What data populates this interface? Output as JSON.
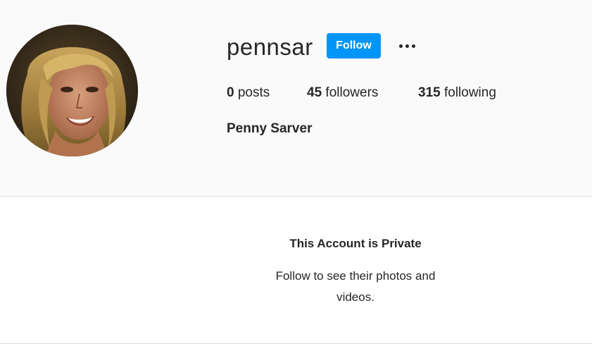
{
  "profile": {
    "username": "pennsar",
    "follow_label": "Follow",
    "full_name": "Penny Sarver",
    "stats": {
      "posts_count": "0",
      "posts_label": "posts",
      "followers_count": "45",
      "followers_label": "followers",
      "following_count": "315",
      "following_label": "following"
    }
  },
  "private_notice": {
    "title": "This Account is Private",
    "message": "Follow to see their photos and videos."
  },
  "icons": {
    "more": "more-options-icon",
    "avatar": "profile-picture"
  },
  "colors": {
    "follow_button": "#0095f6",
    "header_background": "#fafafa",
    "text": "#262626",
    "divider": "#dbdbdb"
  }
}
